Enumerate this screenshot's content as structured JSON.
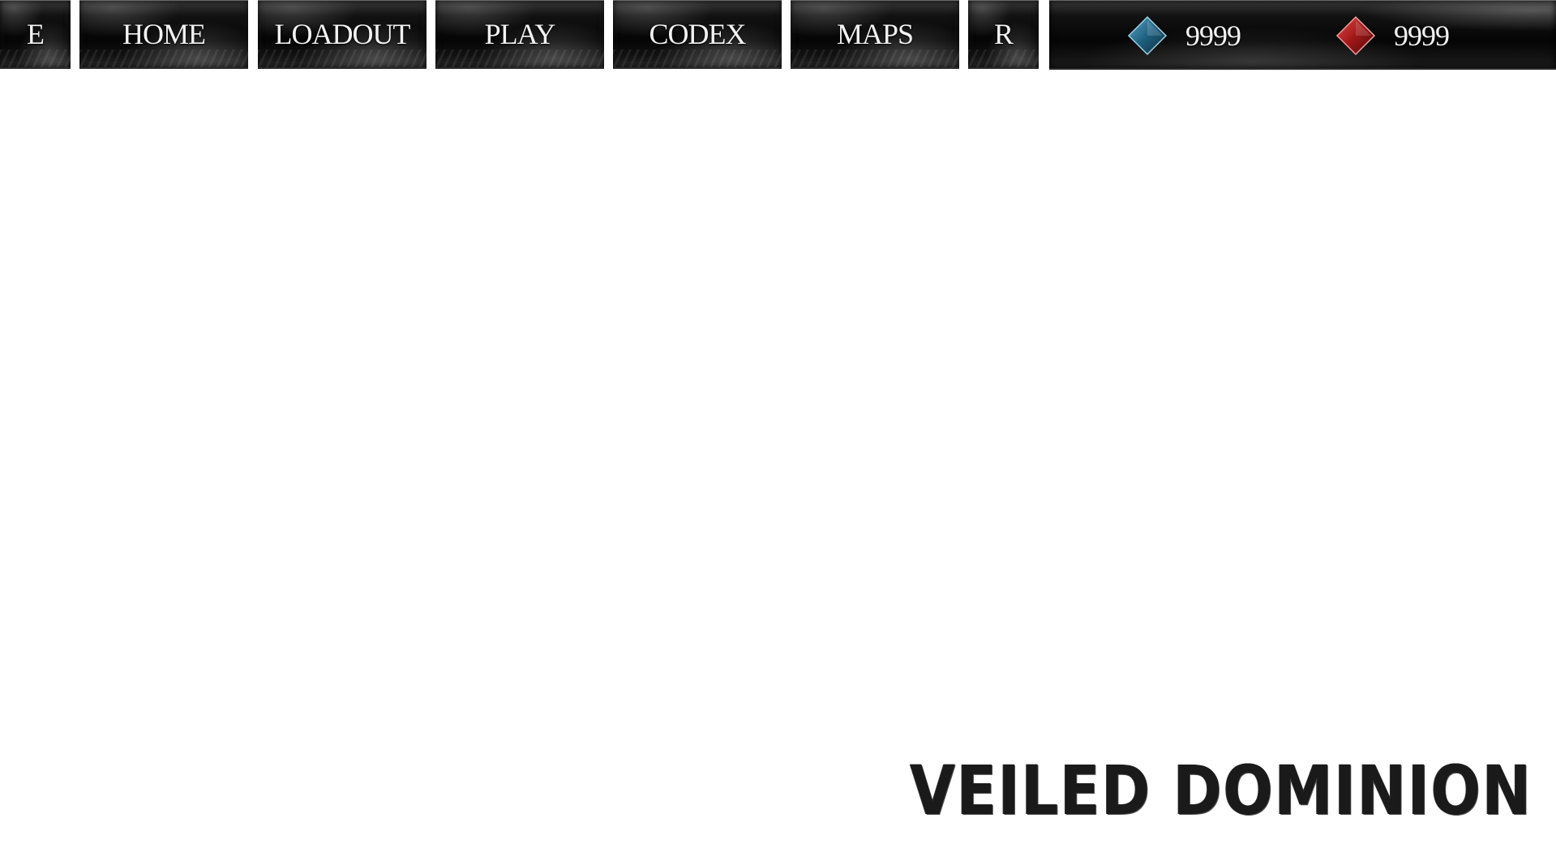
{
  "nav": {
    "e_label": "E",
    "home_label": "HOME",
    "loadout_label": "LOADOUT",
    "play_label": "PLAY",
    "codex_label": "CODEX",
    "maps_label": "MAPS",
    "r_label": "R"
  },
  "currencies": {
    "blue": {
      "icon": "blue-gem-icon",
      "value": "9999",
      "color": "#1f5f7f"
    },
    "red": {
      "icon": "red-gem-icon",
      "value": "9999",
      "color": "#a01818"
    }
  },
  "logo": {
    "text": "VEILED DOMINION"
  }
}
